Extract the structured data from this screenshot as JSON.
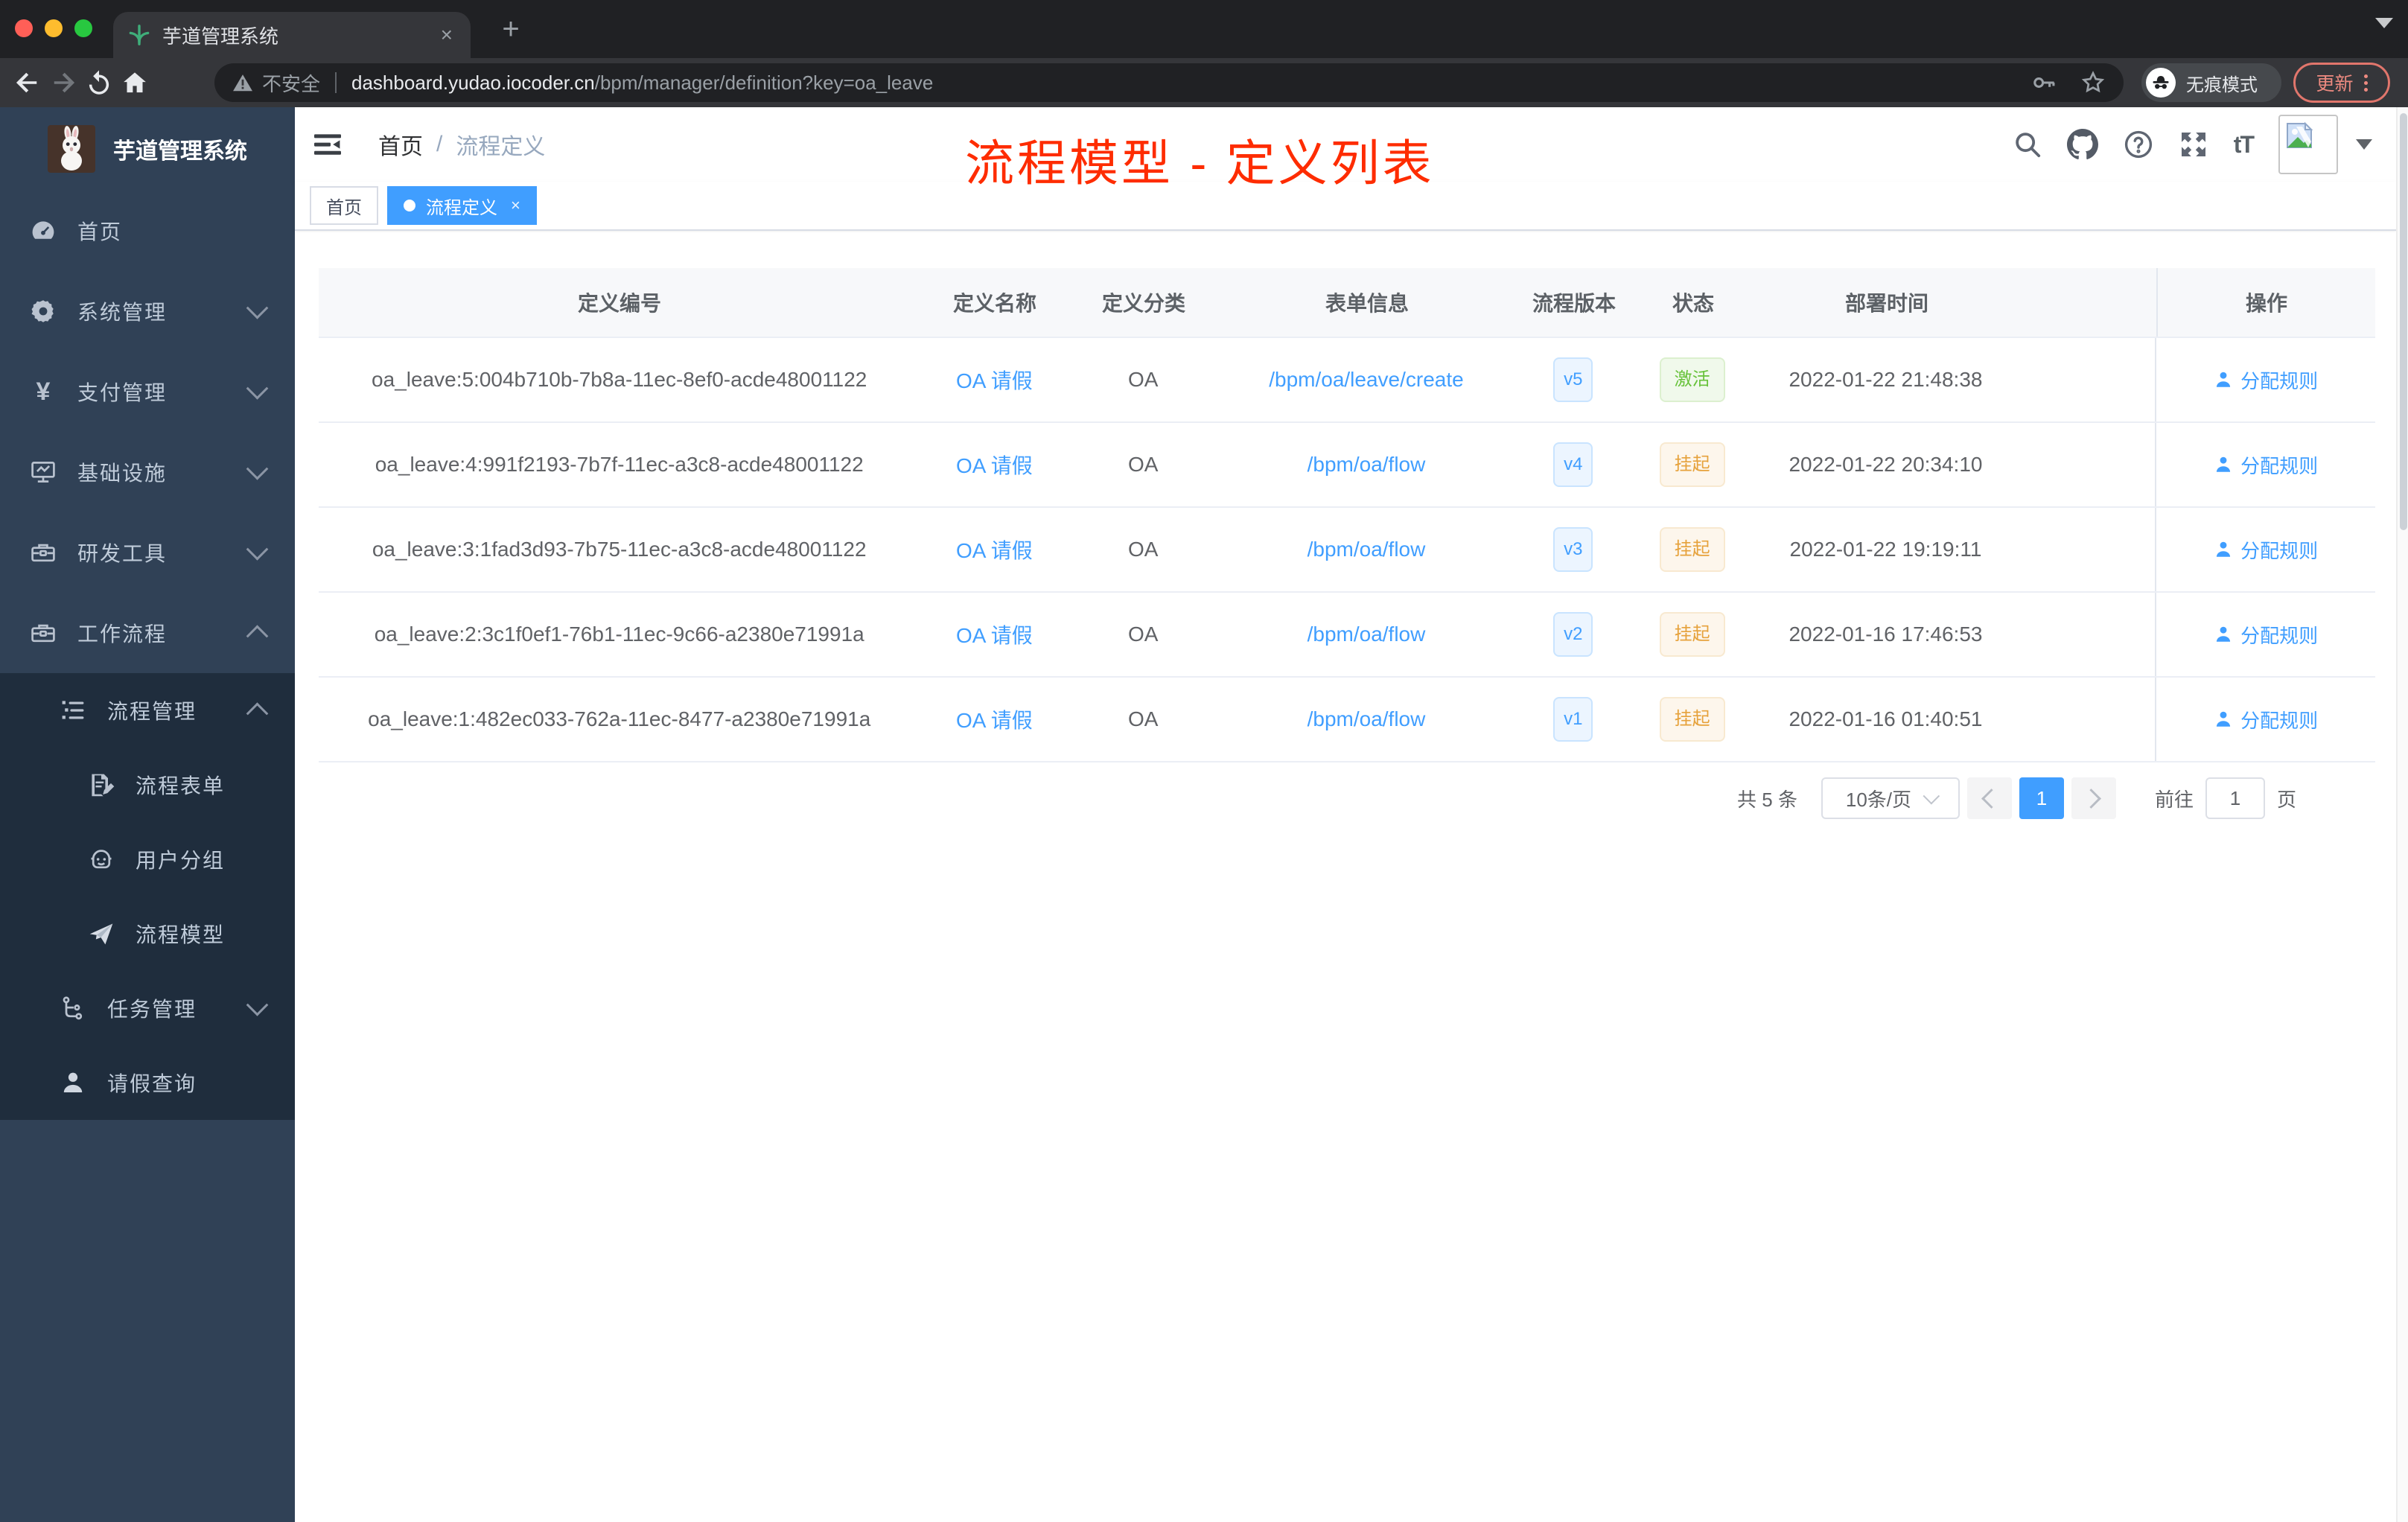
{
  "browser": {
    "tab_title": "芋道管理系统",
    "new_tab_glyph": "+",
    "close_glyph": "×",
    "url": {
      "security_label": "不安全",
      "host": "dashboard.yudao.iocoder.cn",
      "path": "/bpm/manager/definition?key=oa_leave"
    },
    "incognito_label": "无痕模式",
    "update_label": "更新"
  },
  "icons": {
    "favicon": "green-sprig",
    "warning": "triangle-exclamation",
    "key": "saved-password-key",
    "star": "bookmark-star",
    "incognito": "hat-and-glasses",
    "search": "magnifier",
    "github": "octocat",
    "help": "question-circle",
    "fullscreen": "expand-arrows",
    "font_size": "tT",
    "avatar": "broken-image-placeholder",
    "dashboard": "gauge",
    "system": "gear",
    "pay": "yen",
    "infra": "monitor",
    "tools": "toolbox",
    "workflow": "toolbox",
    "process_mgmt": "list",
    "form": "document-pencil",
    "user_group": "robot-face",
    "model": "paper-plane",
    "task": "tree",
    "leave": "person",
    "assign": "person"
  },
  "sidebar": {
    "logo_title": "芋道管理系统",
    "menu": [
      {
        "label": "首页"
      },
      {
        "label": "系统管理"
      },
      {
        "label": "支付管理"
      },
      {
        "label": "基础设施"
      },
      {
        "label": "研发工具"
      },
      {
        "label": "工作流程"
      },
      {
        "label": "流程管理"
      },
      {
        "label": "流程表单"
      },
      {
        "label": "用户分组"
      },
      {
        "label": "流程模型"
      },
      {
        "label": "任务管理"
      },
      {
        "label": "请假查询"
      }
    ]
  },
  "header": {
    "breadcrumb_home": "首页",
    "breadcrumb_sep": "/",
    "breadcrumb_current": "流程定义",
    "font_size_icon_text": "tT"
  },
  "annotation": {
    "text": "流程模型 - 定义列表",
    "color": "#fe2c00"
  },
  "tags": {
    "home": "首页",
    "current": "流程定义",
    "close_glyph": "×"
  },
  "table": {
    "columns": [
      "定义编号",
      "定义名称",
      "定义分类",
      "表单信息",
      "流程版本",
      "状态",
      "部署时间",
      "操作"
    ],
    "rows": [
      {
        "id": "oa_leave:5:004b710b-7b8a-11ec-8ef0-acde48001122",
        "name": "OA 请假",
        "category": "OA",
        "form": "/bpm/oa/leave/create",
        "version": "v5",
        "status": "激活",
        "time": "2022-01-22 21:48:38",
        "action": "分配规则"
      },
      {
        "id": "oa_leave:4:991f2193-7b7f-11ec-a3c8-acde48001122",
        "name": "OA 请假",
        "category": "OA",
        "form": "/bpm/oa/flow",
        "version": "v4",
        "status": "挂起",
        "time": "2022-01-22 20:34:10",
        "action": "分配规则"
      },
      {
        "id": "oa_leave:3:1fad3d93-7b75-11ec-a3c8-acde48001122",
        "name": "OA 请假",
        "category": "OA",
        "form": "/bpm/oa/flow",
        "version": "v3",
        "status": "挂起",
        "time": "2022-01-22 19:19:11",
        "action": "分配规则"
      },
      {
        "id": "oa_leave:2:3c1f0ef1-76b1-11ec-9c66-a2380e71991a",
        "name": "OA 请假",
        "category": "OA",
        "form": "/bpm/oa/flow",
        "version": "v2",
        "status": "挂起",
        "time": "2022-01-16 17:46:53",
        "action": "分配规则"
      },
      {
        "id": "oa_leave:1:482ec033-762a-11ec-8477-a2380e71991a",
        "name": "OA 请假",
        "category": "OA",
        "form": "/bpm/oa/flow",
        "version": "v1",
        "status": "挂起",
        "time": "2022-01-16 01:40:51",
        "action": "分配规则"
      }
    ]
  },
  "pagination": {
    "total": "共 5 条",
    "page_size": "10条/页",
    "current_page": "1",
    "goto_label": "前往",
    "goto_value": "1",
    "unit": "页"
  },
  "colors": {
    "accent": "#409eff",
    "status_active": "#67c23a",
    "status_suspended": "#e6a23c",
    "annotation_red": "#fe2c00",
    "sidebar_bg": "#304156",
    "submenu_bg": "#1f2d3d",
    "chrome_frame": "#202124",
    "chrome_toolbar": "#35363a"
  }
}
